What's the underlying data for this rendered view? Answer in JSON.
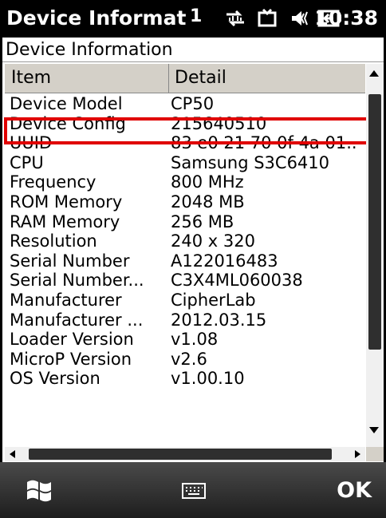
{
  "statusbar": {
    "title": "Device Informat",
    "indicator": "1",
    "icons": [
      "connectivity-icon",
      "sync-icon",
      "volume-icon",
      "battery-icon"
    ],
    "time": "10:38"
  },
  "caption": "Device Information",
  "table": {
    "headers": [
      "Item",
      "Detail"
    ],
    "rows": [
      {
        "item": "Device Model",
        "detail": "CP50"
      },
      {
        "item": "Device Config",
        "detail": "215640510"
      },
      {
        "item": "UUID",
        "detail": "83 e0 21 70 0f 4a 01.."
      },
      {
        "item": "CPU",
        "detail": "Samsung S3C6410"
      },
      {
        "item": "Frequency",
        "detail": "800 MHz"
      },
      {
        "item": "ROM Memory",
        "detail": "2048 MB"
      },
      {
        "item": "RAM Memory",
        "detail": "256 MB"
      },
      {
        "item": "Resolution",
        "detail": "240 x 320"
      },
      {
        "item": "Serial Number",
        "detail": "A122016483"
      },
      {
        "item": "Serial Number...",
        "detail": "C3X4ML060038"
      },
      {
        "item": "Manufacturer",
        "detail": "CipherLab"
      },
      {
        "item": "Manufacturer ...",
        "detail": "2012.03.15"
      },
      {
        "item": "Loader Version",
        "detail": "v1.08"
      },
      {
        "item": "MicroP Version",
        "detail": "v2.6"
      },
      {
        "item": "OS Version",
        "detail": "v1.00.10"
      }
    ]
  },
  "menubar": {
    "ok_label": "OK",
    "icons": [
      "windows-start-icon",
      "keyboard-icon"
    ]
  },
  "highlight_color": "#e00000"
}
